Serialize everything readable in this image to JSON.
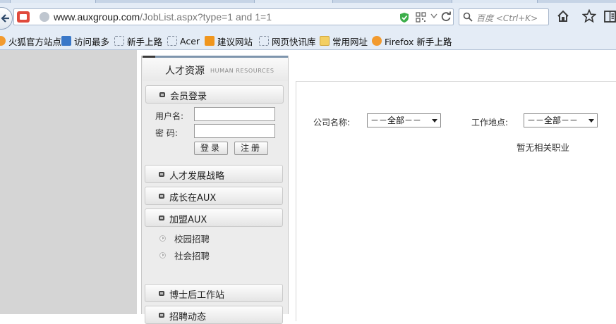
{
  "browser": {
    "url_host": "www.auxgroup.com",
    "url_path": "/JobList.aspx?type=1 and 1=1",
    "search_placeholder": "百度 <Ctrl+K>"
  },
  "bookmarks": [
    {
      "label": "火狐官方站点",
      "icon": "firefox-icon"
    },
    {
      "label": "访问最多",
      "icon": "most-visited-icon"
    },
    {
      "label": "新手上路",
      "icon": "page-icon"
    },
    {
      "label": "Acer",
      "icon": "page-icon"
    },
    {
      "label": "建议网站",
      "icon": "suggested-sites-icon"
    },
    {
      "label": "网页快讯库",
      "icon": "page-icon"
    },
    {
      "label": "常用网址",
      "icon": "folder-icon"
    },
    {
      "label": "Firefox 新手上路",
      "icon": "firefox-icon"
    }
  ],
  "sidebar": {
    "title": "人才资源",
    "subtitle": "HUMAN RESOURCES",
    "login": {
      "title": "会员登录",
      "username_label": "用户名:",
      "password_label": "密  码:",
      "login_button": "登录",
      "register_button": "注册"
    },
    "sections": [
      {
        "label": "人才发展战略"
      },
      {
        "label": "成长在AUX"
      },
      {
        "label": "加盟AUX"
      }
    ],
    "join_items": [
      "校园招聘",
      "社会招聘"
    ],
    "lower_sections": [
      {
        "label": "博士后工作站"
      },
      {
        "label": "招聘动态"
      }
    ]
  },
  "content": {
    "company_label": "公司名称:",
    "company_value": "－－全部－－",
    "location_label": "工作地点:",
    "location_value": "－－全部－－",
    "empty_message": "暂无相关职业"
  }
}
